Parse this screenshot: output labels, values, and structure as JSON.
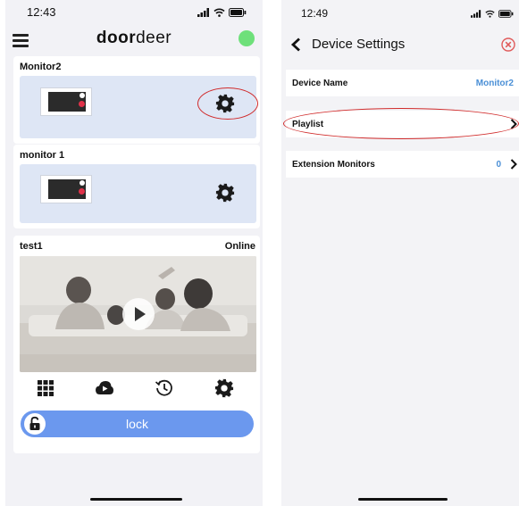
{
  "left_phone": {
    "status": {
      "time": "12:43"
    },
    "app": {
      "logo_bold": "door",
      "logo_light": "deer",
      "status_color": "#6ee07a"
    },
    "devices": [
      {
        "name": "Monitor2"
      },
      {
        "name": "monitor 1"
      }
    ],
    "camera": {
      "name": "test1",
      "status": "Online"
    },
    "lock": {
      "label": "lock"
    }
  },
  "right_phone": {
    "status": {
      "time": "12:49"
    },
    "nav": {
      "title": "Device Settings"
    },
    "rows": [
      {
        "label": "Device Name",
        "value": "Monitor2"
      },
      {
        "label": "Playlist",
        "value": ""
      },
      {
        "label": "Extension Monitors",
        "value": "0"
      }
    ]
  },
  "colors": {
    "accent": "#6b98ee",
    "panel": "#dee6f5",
    "link": "#4a8fd6",
    "annotation": "#d02a2a",
    "close": "#e05a5a"
  }
}
